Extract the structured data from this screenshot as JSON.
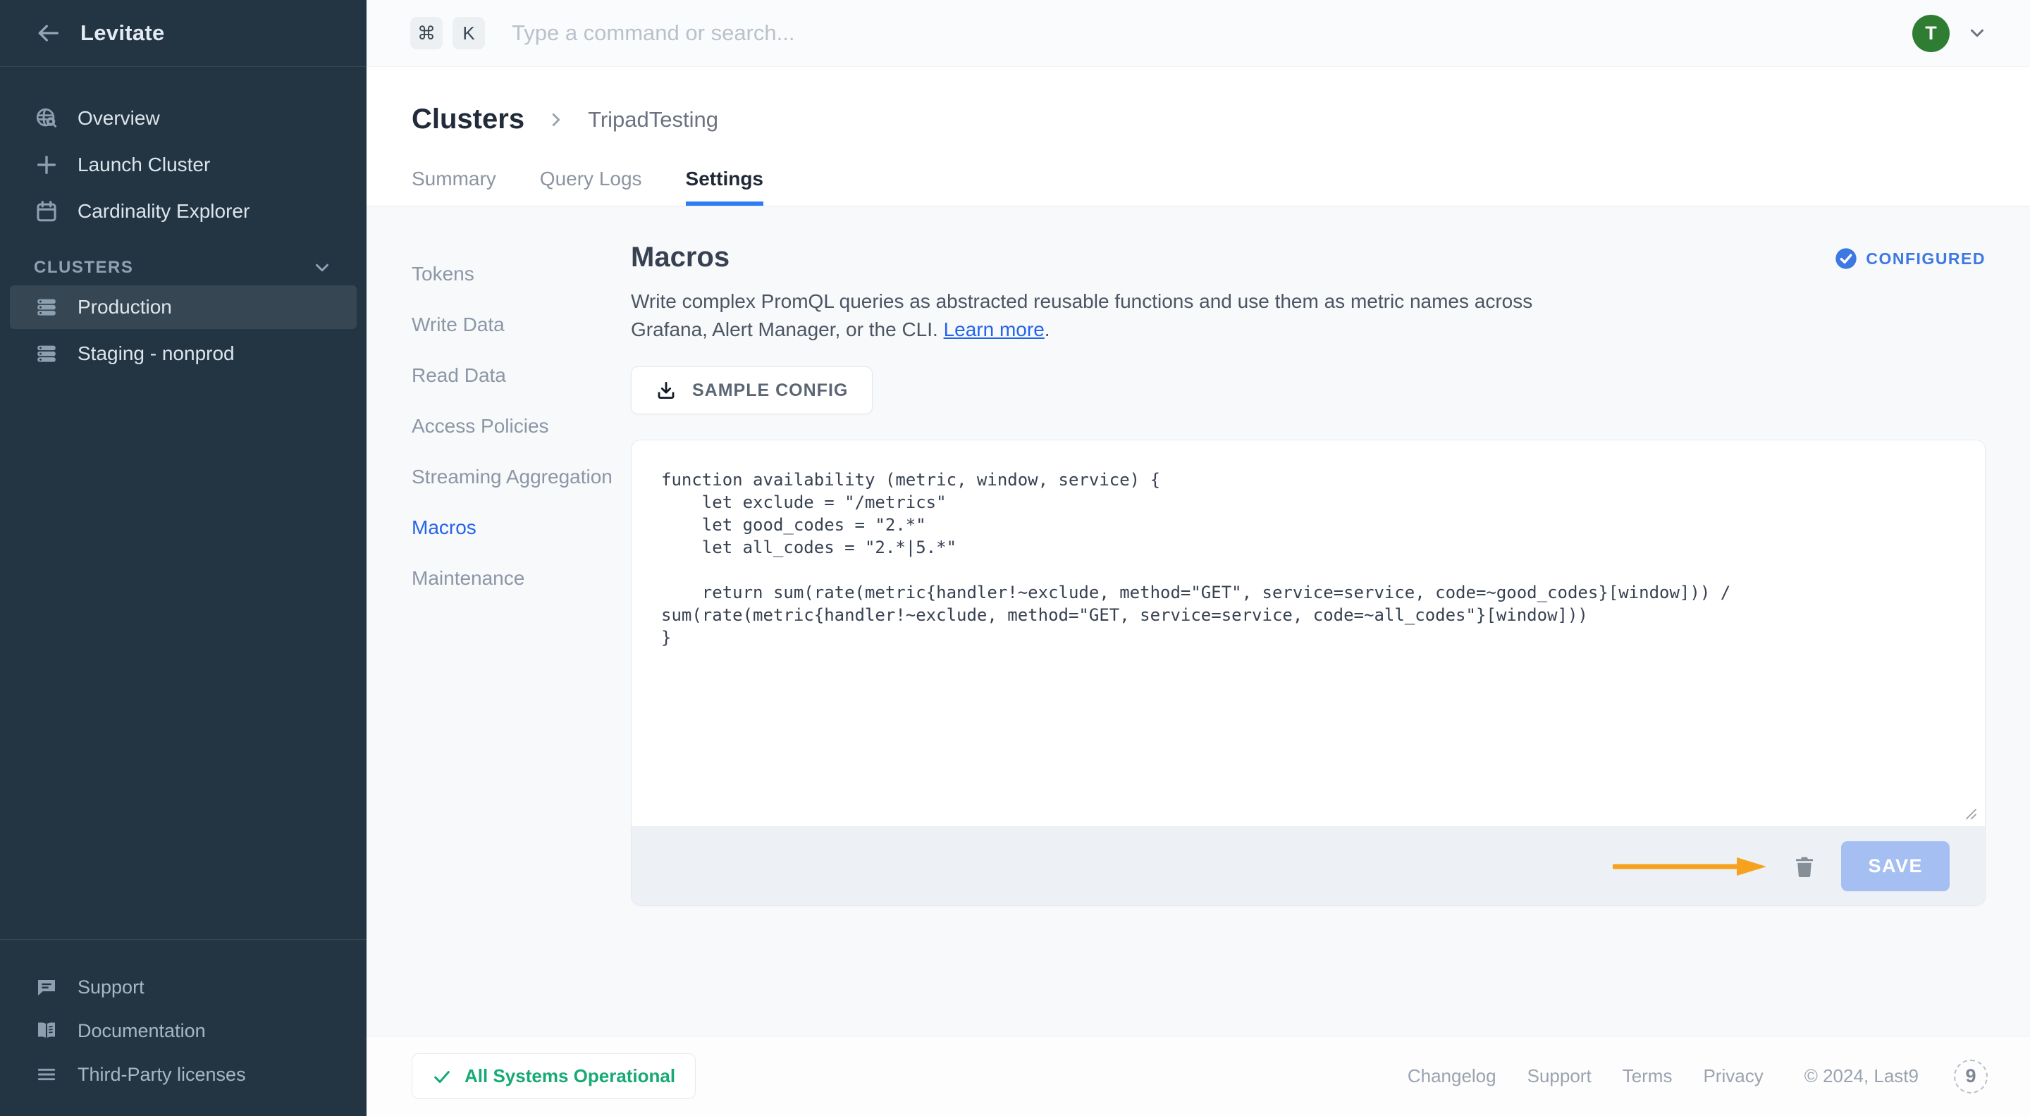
{
  "sidebar": {
    "brand": "Levitate",
    "nav": [
      {
        "label": "Overview",
        "icon": "globe-search-icon"
      },
      {
        "label": "Launch Cluster",
        "icon": "plus-icon"
      },
      {
        "label": "Cardinality Explorer",
        "icon": "calendar-icon"
      }
    ],
    "clusters_section_label": "CLUSTERS",
    "clusters": [
      {
        "label": "Production",
        "active": true
      },
      {
        "label": "Staging - nonprod",
        "active": false
      }
    ],
    "footer_nav": [
      {
        "label": "Support",
        "icon": "chat-icon"
      },
      {
        "label": "Documentation",
        "icon": "book-icon"
      },
      {
        "label": "Third-Party licenses",
        "icon": "lines-icon"
      }
    ]
  },
  "topbar": {
    "key_cmd": "⌘",
    "key_k": "K",
    "search_placeholder": "Type a command or search...",
    "avatar_initial": "T"
  },
  "breadcrumb": {
    "root": "Clusters",
    "current": "TripadTesting"
  },
  "tabs": [
    {
      "label": "Summary",
      "active": false
    },
    {
      "label": "Query Logs",
      "active": false
    },
    {
      "label": "Settings",
      "active": true
    }
  ],
  "settings_nav": [
    {
      "label": "Tokens",
      "active": false
    },
    {
      "label": "Write Data",
      "active": false
    },
    {
      "label": "Read Data",
      "active": false
    },
    {
      "label": "Access Policies",
      "active": false
    },
    {
      "label": "Streaming Aggregation",
      "active": false
    },
    {
      "label": "Macros",
      "active": true
    },
    {
      "label": "Maintenance",
      "active": false
    }
  ],
  "macros": {
    "title": "Macros",
    "status_badge": "CONFIGURED",
    "description_line1": "Write complex PromQL queries as abstracted reusable functions and use them as metric names across",
    "description_line2": "Grafana, Alert Manager, or the CLI.",
    "learn_more_label": "Learn more",
    "learn_more_suffix": ".",
    "sample_config_label": "SAMPLE CONFIG",
    "code": "function availability (metric, window, service) {\n    let exclude = \"/metrics\"\n    let good_codes = \"2.*\"\n    let all_codes = \"2.*|5.*\"\n\n    return sum(rate(metric{handler!~exclude, method=\"GET\", service=service, code=~good_codes}[window])) /\nsum(rate(metric{handler!~exclude, method=\"GET, service=service, code=~all_codes\"}[window]))\n}",
    "save_label": "SAVE"
  },
  "footer": {
    "status": "All Systems Operational",
    "links": [
      "Changelog",
      "Support",
      "Terms",
      "Privacy"
    ],
    "copyright": "© 2024, Last9",
    "logo_text": "9"
  },
  "colors": {
    "sidebar_bg": "#233543",
    "accent_blue": "#2563eb",
    "tab_underline": "#2f7df6",
    "configured_blue": "#3d78e3",
    "save_button": "#a5bff2",
    "annotation_orange": "#f6a21e",
    "status_green": "#17aa75",
    "avatar_green": "#2e7d32"
  }
}
